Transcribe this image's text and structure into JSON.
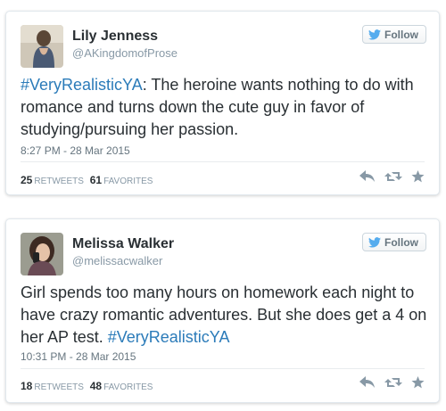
{
  "follow_label": "Follow",
  "colors": {
    "hashtag": "#2b7bb9",
    "border": "#e1e8ed",
    "muted": "#8899a6",
    "text": "#292f33",
    "twitter_blue": "#55acee"
  },
  "tweets": [
    {
      "name": "Lily Jenness",
      "handle": "@AKingdomofProse",
      "hashtag": "#VeryRealisticYA",
      "text_after_hashtag": ": The heroine wants nothing to do with romance and turns down the cute guy in favor of studying/pursuing her passion.",
      "timestamp": "8:27 PM - 28 Mar 2015",
      "retweets": "25",
      "retweets_label": "RETWEETS",
      "favorites": "61",
      "favorites_label": "FAVORITES",
      "avatar_icon": "woman-back-photo-avatar"
    },
    {
      "name": "Melissa Walker",
      "handle": "@melissacwalker",
      "text_before_hashtag": "Girl spends too many hours on homework each night to have crazy romantic adventures. But she does get a 4 on her AP test. ",
      "hashtag": "#VeryRealisticYA",
      "timestamp": "10:31 PM - 28 Mar 2015",
      "retweets": "18",
      "retweets_label": "RETWEETS",
      "favorites": "48",
      "favorites_label": "FAVORITES",
      "avatar_icon": "woman-on-phone-photo-avatar"
    }
  ],
  "icons": {
    "follow": "twitter-bird-icon",
    "reply": "reply-arrow-icon",
    "retweet": "retweet-icon",
    "favorite": "star-icon"
  }
}
